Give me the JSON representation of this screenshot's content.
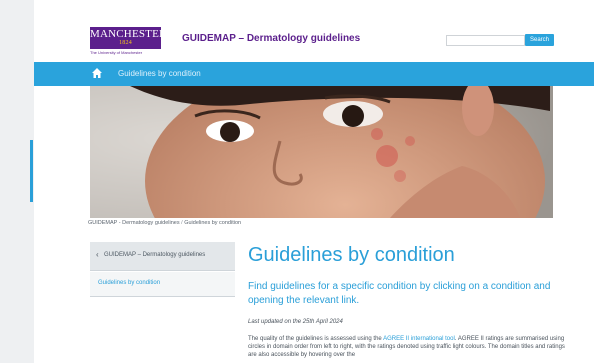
{
  "header": {
    "logo_text": "MANCHESTER",
    "logo_year": "1824",
    "logo_sub": "The University of Manchester",
    "site_title": "GUIDEMAP – Dermatology guidelines",
    "search_placeholder": "",
    "search_label": "Search"
  },
  "nav": {
    "link": "Guidelines by condition"
  },
  "breadcrumb": {
    "home": "GUIDEMAP - Dermatology guidelines",
    "separator": "/",
    "current": "Guidelines by condition"
  },
  "sidebar": {
    "back_label": "GUIDEMAP – Dermatology guidelines",
    "items": [
      {
        "label": "Guidelines by condition"
      }
    ]
  },
  "main": {
    "title": "Guidelines by condition",
    "intro": "Find guidelines for a specific condition by clicking on a condition and opening the relevant link.",
    "updated": "Last updated on the 25th April 2024",
    "body_pre": "The quality of the guidelines is assessed using the ",
    "body_link": "AGREE II international tool",
    "body_post": ". AGREE II ratings are summarised using circles in domain order from left to right, with the ratings denoted using traffic light colours. The domain titles and ratings are also accessible by hovering over the"
  },
  "colors": {
    "brand_purple": "#5b1f8c",
    "accent_blue": "#2aa3dc",
    "logo_gold": "#f3c31a"
  },
  "icons": {
    "home": "home-icon",
    "chevron": "chevron-left-icon"
  }
}
